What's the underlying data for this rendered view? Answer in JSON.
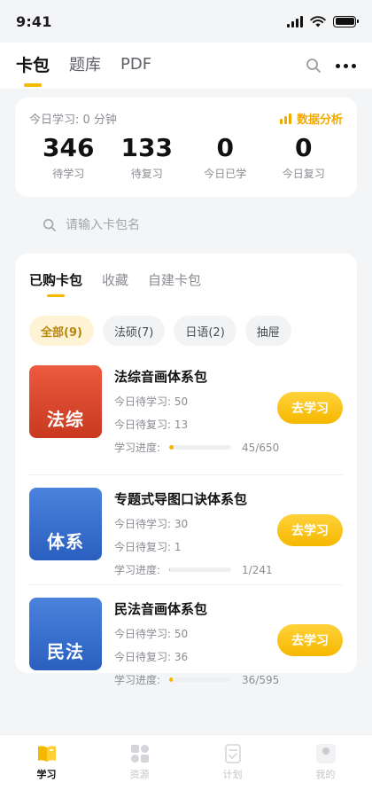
{
  "status": {
    "time": "9:41"
  },
  "header": {
    "tabs": [
      {
        "label": "卡包",
        "active": true
      },
      {
        "label": "题库",
        "active": false
      },
      {
        "label": "PDF",
        "active": false
      }
    ]
  },
  "stats": {
    "today_study": "今日学习: 0 分钟",
    "analysis_label": "数据分析",
    "items": [
      {
        "value": "346",
        "label": "待学习"
      },
      {
        "value": "133",
        "label": "待复习"
      },
      {
        "value": "0",
        "label": "今日已学"
      },
      {
        "value": "0",
        "label": "今日复习"
      }
    ]
  },
  "search": {
    "placeholder": "请输入卡包名"
  },
  "packs": {
    "tabs": [
      {
        "label": "已购卡包",
        "active": true
      },
      {
        "label": "收藏",
        "active": false
      },
      {
        "label": "自建卡包",
        "active": false
      }
    ],
    "chips": [
      {
        "label": "全部(9)",
        "active": true
      },
      {
        "label": "法硕(7)",
        "active": false
      },
      {
        "label": "日语(2)",
        "active": false
      },
      {
        "label": "抽屉",
        "active": false
      }
    ],
    "progress_label": "学习进度:",
    "button_label": "去学习",
    "items": [
      {
        "cover_text": "法综",
        "cover_color_top": "#ec5a3f",
        "cover_color_bottom": "#c8391f",
        "title": "法综音画体系包",
        "to_learn": "今日待学习: 50",
        "to_review": "今日待复习: 13",
        "progress_text": "45/650",
        "progress": 0.069
      },
      {
        "cover_text": "体系",
        "cover_color_top": "#4a82dc",
        "cover_color_bottom": "#2a5fbf",
        "title": "专题式导图口诀体系包",
        "to_learn": "今日待学习: 30",
        "to_review": "今日待复习: 1",
        "progress_text": "1/241",
        "progress": 0.004
      },
      {
        "cover_text": "民法",
        "cover_color_top": "#4a82dc",
        "cover_color_bottom": "#2a5fbf",
        "title": "民法音画体系包",
        "to_learn": "今日待学习: 50",
        "to_review": "今日待复习: 36",
        "progress_text": "36/595",
        "progress": 0.06
      }
    ]
  },
  "nav": {
    "items": [
      {
        "label": "学习",
        "icon": "book-icon",
        "active": true
      },
      {
        "label": "资源",
        "icon": "grid-icon",
        "active": false
      },
      {
        "label": "计划",
        "icon": "plan-icon",
        "active": false
      },
      {
        "label": "我的",
        "icon": "profile-icon",
        "active": false
      }
    ]
  },
  "colors": {
    "accent": "#f5b800",
    "accent_text": "#f2a900"
  }
}
